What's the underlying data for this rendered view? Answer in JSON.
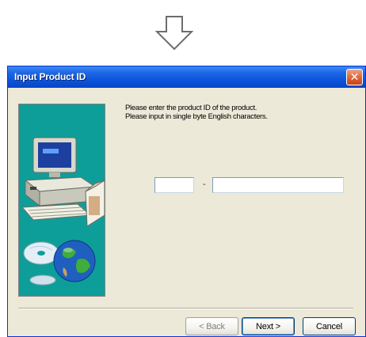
{
  "window": {
    "title": "Input Product ID",
    "close_glyph": "✕"
  },
  "prompt": {
    "line1": "Please enter the product ID of the product.",
    "line2": "Please input in single byte English characters."
  },
  "product_id": {
    "part1_value": "",
    "separator": "-",
    "part2_value": ""
  },
  "buttons": {
    "back": "< Back",
    "next": "Next >",
    "cancel": "Cancel"
  },
  "icons": {
    "arrow": "down-arrow-icon",
    "close": "close-icon",
    "illustration": "computer-cd-globe-illustration"
  },
  "colors": {
    "titlebar": "#0a52d8",
    "panel": "#0e9e9a",
    "dialog": "#ece9d8"
  }
}
